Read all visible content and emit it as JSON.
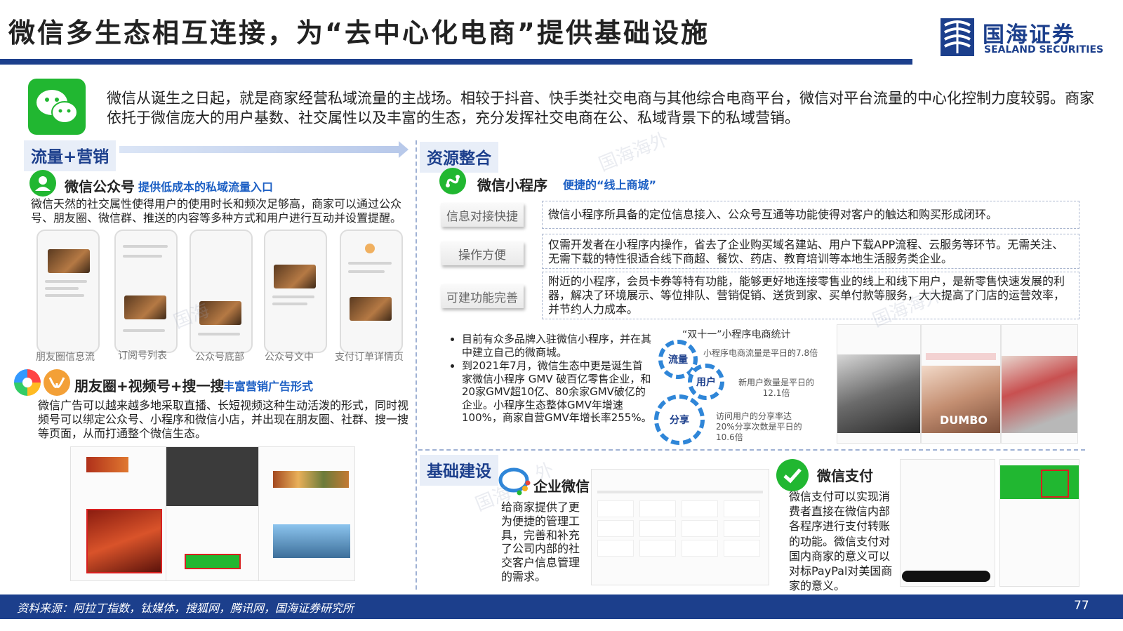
{
  "header": {
    "title": "微信多生态相互连接，为“去中心化电商”提供基础设施",
    "logo_cn": "国海证券",
    "logo_en": "SEALAND SECURITIES"
  },
  "intro": "微信从诞生之日起，就是商家经营私域流量的主战场。相较于抖音、快手类社交电商与其他综合电商平台，微信对平台流量的中心化控制力度较弱。商家依托于微信庞大的用户基数、社交属性以及丰富的生态，充分发挥社交电商在公、私域背景下的私域营销。",
  "traffic": {
    "label": "流量+营销",
    "official": {
      "name": "微信公众号",
      "tag": "提供低成本的私域流量入口",
      "text": "微信天然的社交属性使得用户的使用时长和频次足够高，商家可以通过公众号、朋友圈、微信群、推送的内容等多种方式和用户进行互动并设置提醒。",
      "screens": [
        "朋友圈信息流",
        "订阅号列表",
        "公众号底部",
        "公众号文中",
        "支付订单详情页"
      ]
    },
    "moments": {
      "name": "朋友圈+视频号+搜一搜",
      "tag": "丰富营销广告形式",
      "text": "微信广告可以越来越多地采取直播、长短视频这种生动活泼的形式，同时视频号可以绑定公众号、小程序和微信小店，并出现在朋友圈、社群、搜一搜等页面，从而打通整个微信生态。"
    }
  },
  "resources": {
    "label": "资源整合",
    "miniapp": {
      "name": "微信小程序",
      "tag": "便捷的“线上商城”"
    },
    "features": [
      {
        "label": "信息对接快捷",
        "text": "微信小程序所具备的定位信息接入、公众号互通等功能使得对客户的触达和购买形成闭环。"
      },
      {
        "label": "操作方便",
        "text": "仅需开发者在小程序内操作，省去了企业购买域名建站、用户下载APP流程、云服务等环节。无需关注、无需下载的特性很适合线下商超、餐饮、药店、教育培训等本地生活服务类企业。"
      },
      {
        "label": "可建功能完善",
        "text": "附近的小程序，会员卡券等特有功能，能够更好地连接零售业的线上和线下用户，是新零售快速发展的利器，解决了环境展示、等位排队、营销促销、送货到家、买单付款等服务，大大提高了门店的运营效率，并节约人力成本。"
      }
    ],
    "bullets": [
      "目前有众多品牌入驻微信小程序，并在其中建立自己的微商城。",
      "到2021年7月，微信生态中更是诞生首家微信小程序 GMV 破百亿零售企业，和20家GMV超10亿、80余家GMV破亿的企业。小程序生态整体GMV年增速 100%，商家自营GMV年增长率255%。"
    ],
    "stats": {
      "title": "“双十一”小程序电商统计",
      "items": [
        {
          "gear": "流量",
          "text": "小程序电商流量是平日的7.8倍"
        },
        {
          "gear": "用户",
          "text": "新用户数量是平日的12.1倍"
        },
        {
          "gear": "分享",
          "text": "访问用户的分享率达20%分享次数是平日的10.6倍"
        }
      ]
    },
    "shop_banner": "DUMBO"
  },
  "infra": {
    "label": "基础建设",
    "wecom": {
      "name": "企业微信",
      "text": "给商家提供了更为便捷的管理工具，完善和补充了公司内部的社交客户信息管理的需求。"
    },
    "pay": {
      "name": "微信支付",
      "text": "微信支付可以实现消费者直接在微信内部各程序进行支付转账的功能。微信支付对国内商家的意义可以对标PayPal对美国商家的意义。"
    }
  },
  "watermarks": [
    "国海海外",
    "国海海外",
    "国海",
    "外",
    "国海"
  ],
  "footer": {
    "source": "资料来源：阿拉丁指数，钛媒体，搜狐网，腾讯网，国海证券研究所",
    "page": "77"
  },
  "colors": {
    "brand": "#1c3f8c",
    "wechat_green": "#21b731",
    "tag_blue": "#1c5fc4"
  }
}
